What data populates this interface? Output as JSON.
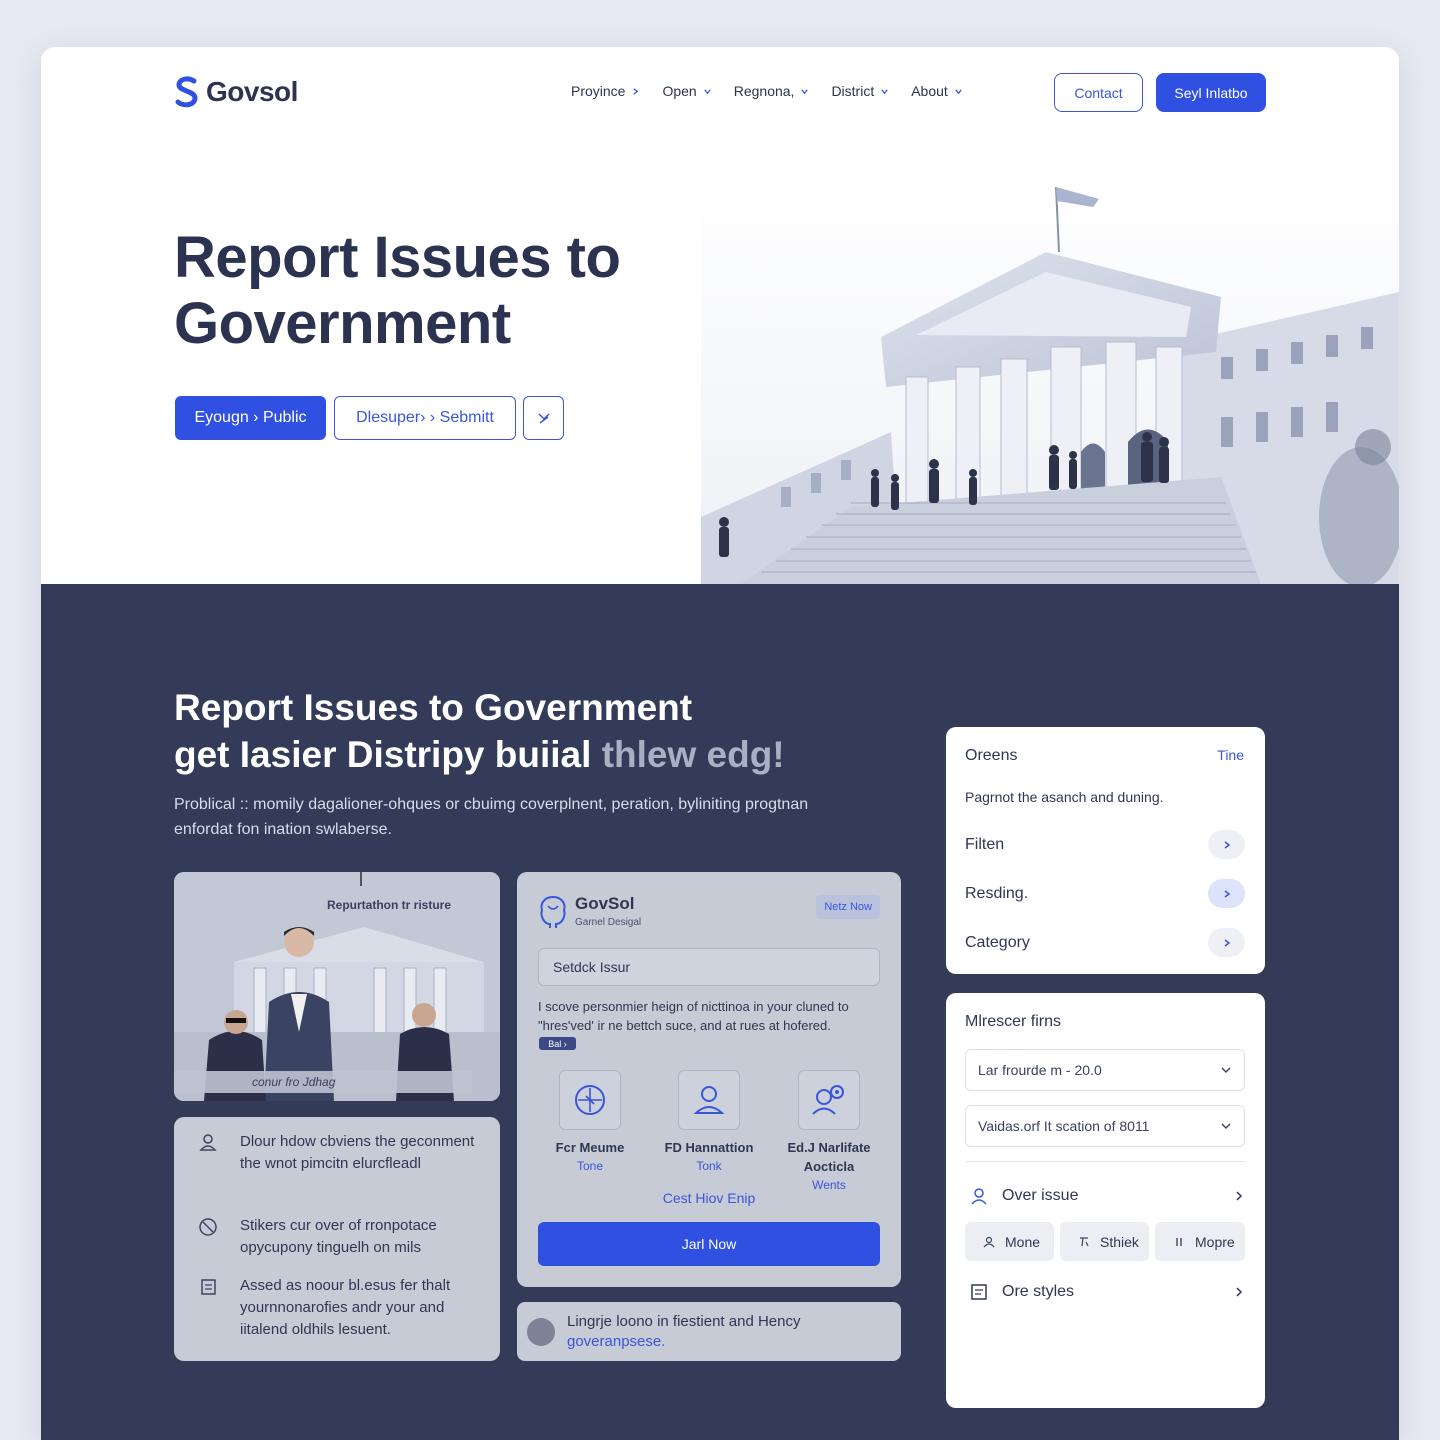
{
  "brand": {
    "name": "Govsol",
    "color": "#2f50e0"
  },
  "nav": {
    "items": [
      {
        "label": "Proyince"
      },
      {
        "label": "Open"
      },
      {
        "label": "Regnona,"
      },
      {
        "label": "District"
      },
      {
        "label": "About"
      }
    ],
    "contact_label": "Contact",
    "signin_label": "Seyl Inlatbo"
  },
  "hero": {
    "title": "Report Issues to Government",
    "btn_primary": "Eyougn › Public",
    "btn_secondary": "Dlesuper› › Sebmitt",
    "close_icon": "close-icon"
  },
  "section": {
    "title_line1": "Report Issues to Government",
    "title_line2_main": "get Iasier Distripy buiial",
    "title_line2_muted": "thlew edg!",
    "description": "Problical :: momily dagalioner-ohques or cbuimg coverplnent, peration, byliniting progtnan enfordat fon ination swlaberse."
  },
  "photo_card": {
    "caption_top": "Repurtathon tr risture",
    "caption_bottom": "conur fro Jdhag"
  },
  "list_card": {
    "items": [
      {
        "icon": "user-icon",
        "text": "Dlour hdow cbviens the geconment the wnot pimcitn elurcfleadl"
      },
      {
        "icon": "block-icon",
        "text": "Stikers cur over of rronpotace opycupony tinguelh on mils"
      },
      {
        "icon": "document-icon",
        "text": "Assed as noour bl.esus fer thalt yournnonarofies andr your and iitalend oldhils lesuent."
      }
    ]
  },
  "mid_card": {
    "logo_name": "GovSol",
    "logo_sub": "Garnel Desigal",
    "badge": "Netz Now",
    "search_placeholder": "Setdck Issur",
    "text": "I scove personmier heign of nicttinoa in your cluned to \"hres'ved' ir ne bettch suce, and at rues at hofered.",
    "tag": "Bal ›",
    "features": [
      {
        "icon": "compass-icon",
        "title": "Fcr Meume",
        "sub": "Tone"
      },
      {
        "icon": "person-icon",
        "title": "FD Hannattion",
        "sub": "Tonk"
      },
      {
        "icon": "settings-user-icon",
        "title": "Ed.J Narlifate Aocticla",
        "sub": "Wents"
      }
    ],
    "link": "Cest Hiov Enip",
    "join_label": "Jarl Now"
  },
  "news_card": {
    "text": "Lingrje loono in fiestient and Hency",
    "link": "goveranpsese."
  },
  "filter_card": {
    "title": "Oreens",
    "time_link": "Tine",
    "description": "Pagrnot the asanch and duning.",
    "rows": [
      {
        "label": "Filten"
      },
      {
        "label": "Resding."
      },
      {
        "label": "Category"
      }
    ]
  },
  "more_card": {
    "title": "Mlrescer firns",
    "select1": "Lar frourde m - 20.0",
    "select2": "Vaidas.orf It scation of 8011",
    "row1": "Over issue",
    "chips": [
      {
        "label": "Mone"
      },
      {
        "label": "Sthiek"
      },
      {
        "label": "Mopre"
      }
    ],
    "row2": "Ore styles"
  }
}
